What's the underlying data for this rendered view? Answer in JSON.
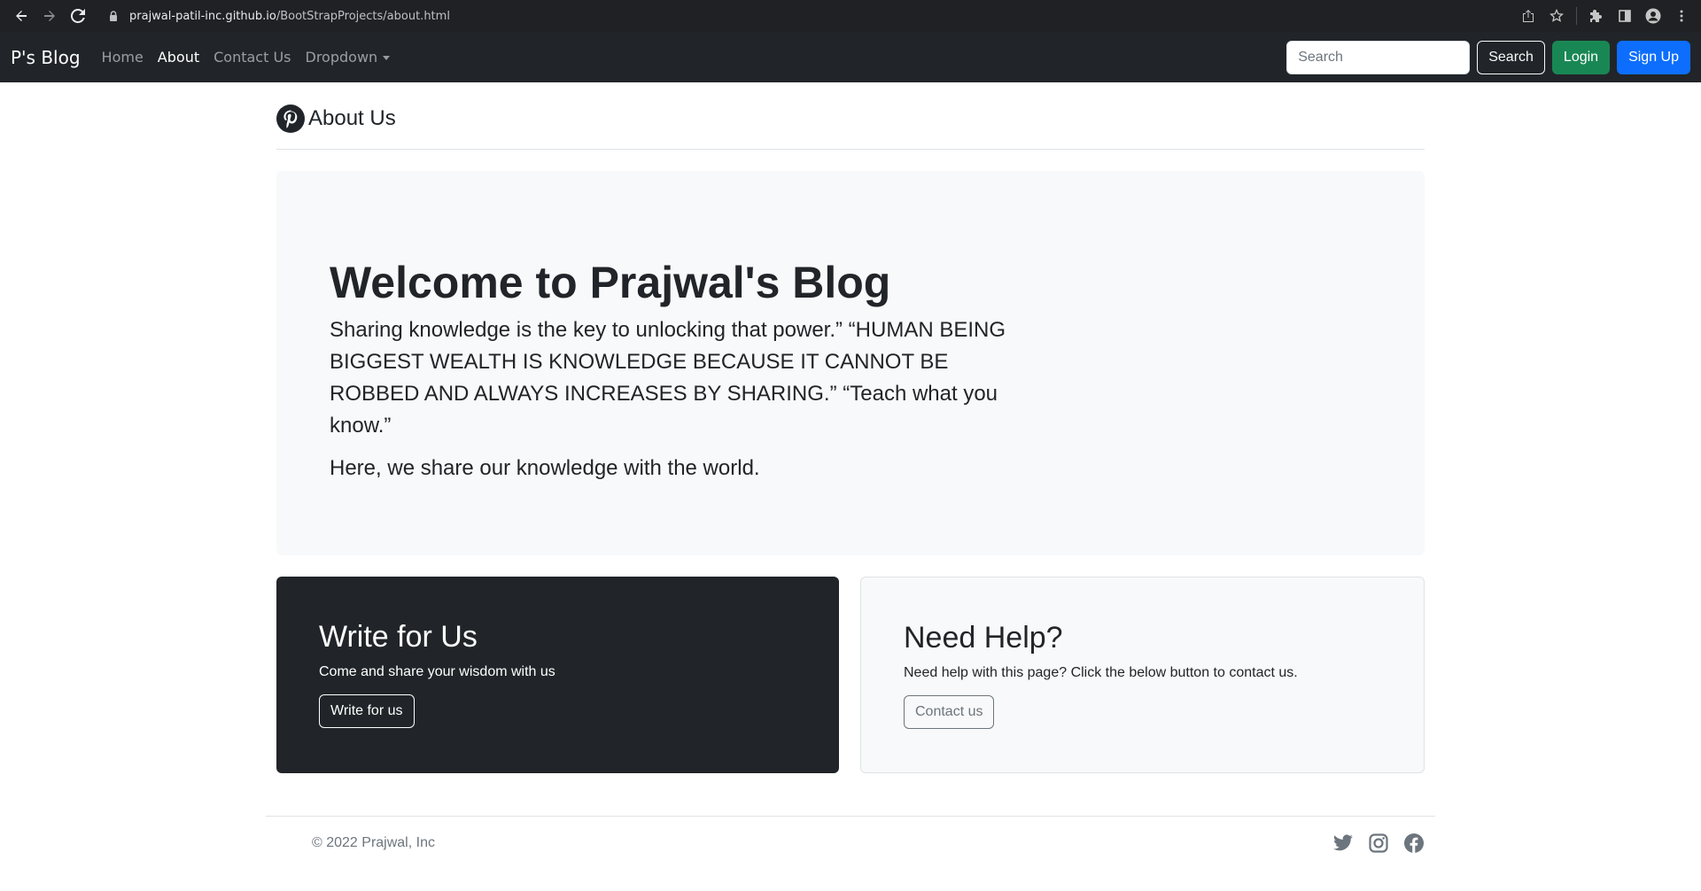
{
  "browser": {
    "url_host": "prajwal-patil-inc.github.io",
    "url_path": "/BootStrapProjects/about.html"
  },
  "navbar": {
    "brand": "P's Blog",
    "links": [
      {
        "label": "Home"
      },
      {
        "label": "About"
      },
      {
        "label": "Contact Us"
      },
      {
        "label": "Dropdown"
      }
    ],
    "search_placeholder": "Search",
    "search_button": "Search",
    "login_button": "Login",
    "signup_button": "Sign Up"
  },
  "header": {
    "title": "About Us"
  },
  "hero": {
    "heading": "Welcome to Prajwal's Blog",
    "lead": "Sharing knowledge is the key to unlocking that power.” “HUMAN BEING BIGGEST WEALTH IS KNOWLEDGE BECAUSE IT CANNOT BE ROBBED AND ALWAYS INCREASES BY SHARING.” “Teach what you know.”",
    "lead2": "Here, we share our knowledge with the world."
  },
  "write_card": {
    "heading": "Write for Us",
    "text": "Come and share your wisdom with us",
    "button": "Write for us"
  },
  "help_card": {
    "heading": "Need Help?",
    "text": "Need help with this page? Click the below button to contact us.",
    "button": "Contact us"
  },
  "footer": {
    "copyright": "© 2022 Prajwal, Inc",
    "social": [
      "twitter-icon",
      "instagram-icon",
      "facebook-icon"
    ]
  },
  "colors": {
    "navbar_bg": "#212529",
    "success": "#198754",
    "primary": "#0d6efd",
    "light_bg": "#f8f9fa"
  }
}
